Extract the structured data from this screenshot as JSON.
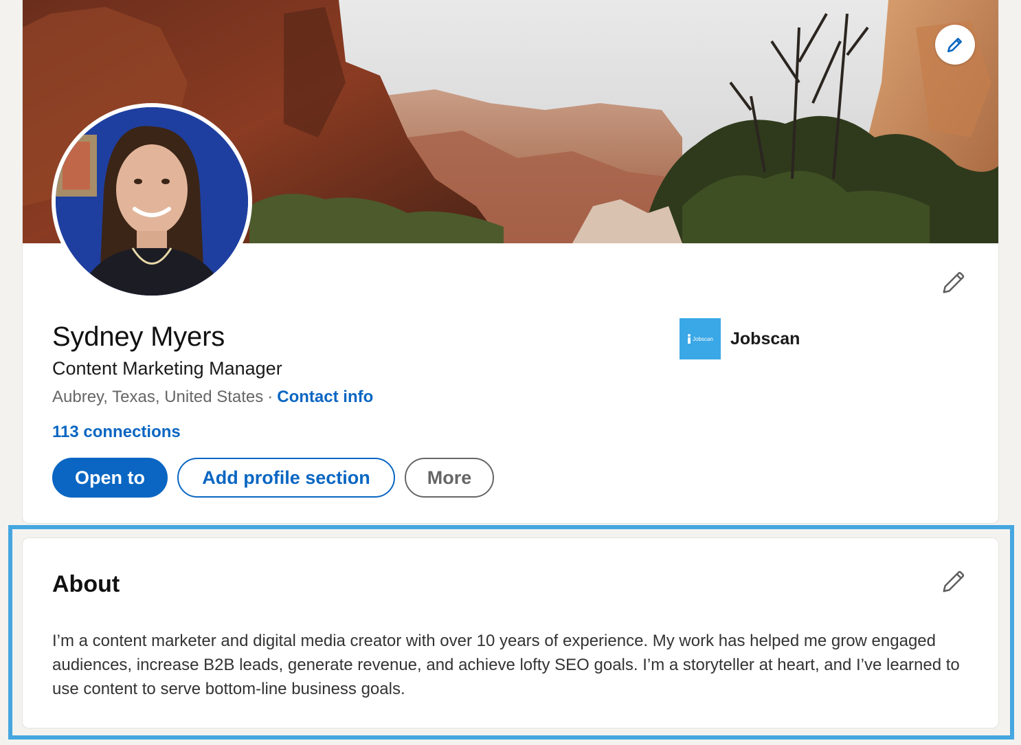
{
  "profile": {
    "name": "Sydney Myers",
    "headline": "Content Marketing Manager",
    "location": "Aubrey, Texas, United States",
    "separator": "·",
    "contact_info_label": "Contact info",
    "connections": "113 connections",
    "company": {
      "name": "Jobscan",
      "logo_text": "Jobscan",
      "logo_color": "#3aa7e6"
    },
    "buttons": {
      "open_to": "Open to",
      "add_section": "Add profile section",
      "more": "More"
    }
  },
  "about": {
    "title": "About",
    "text": "I’m a content marketer and digital media creator with over 10 years of experience. My work has helped me grow engaged audiences, increase B2B leads, generate revenue, and achieve lofty SEO goals. I’m a storyteller at heart, and I’ve learned to use content to serve bottom-line business goals."
  },
  "icons": {
    "cover_edit": "pencil-icon",
    "intro_edit": "pencil-icon",
    "about_edit": "pencil-icon"
  },
  "colors": {
    "brand_blue": "#0a66c2",
    "highlight": "#45a6e0",
    "page_bg": "#f3f2ef"
  }
}
